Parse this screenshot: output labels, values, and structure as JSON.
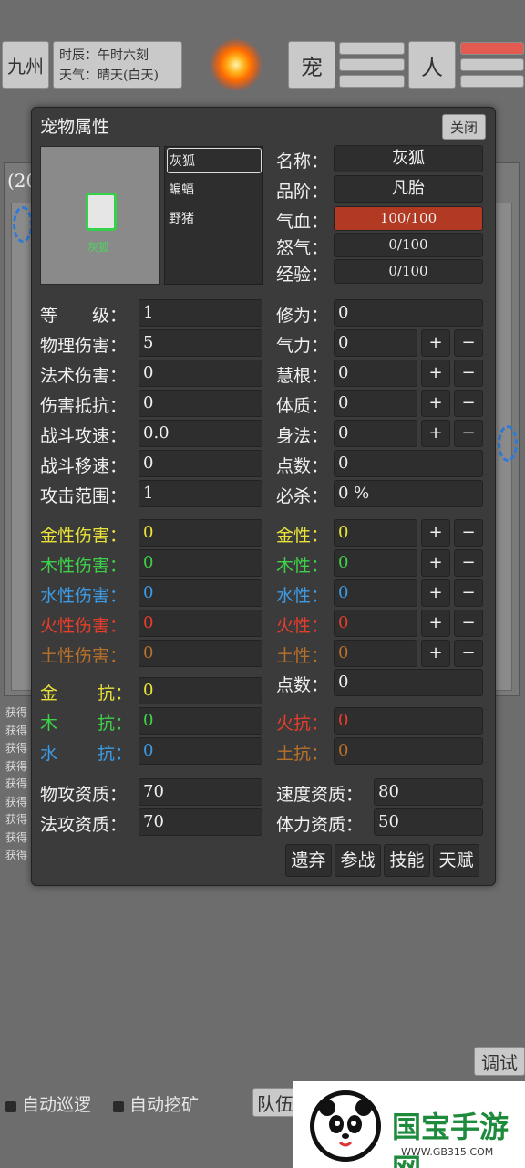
{
  "topbar": {
    "region": "九州",
    "time_line": "时辰：午时六刻",
    "weather_line": "天气：晴天(白天)",
    "pet_tab": "宠",
    "person_tab": "人"
  },
  "background": {
    "partial_label": "(20",
    "log_entry": "获得"
  },
  "modal": {
    "title": "宠物属性",
    "close": "关闭",
    "portrait_name": "灰狐",
    "pets": [
      "灰狐",
      "蝙蝠",
      "野猪"
    ],
    "info": {
      "name_label": "名称：",
      "name": "灰狐",
      "rank_label": "品阶：",
      "rank": "凡胎",
      "hp_label": "气血：",
      "hp": "100/100",
      "rage_label": "怒气：",
      "rage": "0/100",
      "exp_label": "经验：",
      "exp": "0/100"
    },
    "stats_left": [
      {
        "label": "等　　级：",
        "value": "1"
      },
      {
        "label": "物理伤害：",
        "value": "5"
      },
      {
        "label": "法术伤害：",
        "value": "0"
      },
      {
        "label": "伤害抵抗：",
        "value": "0"
      },
      {
        "label": "战斗攻速：",
        "value": "0.0"
      },
      {
        "label": "战斗移速：",
        "value": "0"
      },
      {
        "label": "攻击范围：",
        "value": "1"
      }
    ],
    "stats_right": [
      {
        "label": "修为：",
        "value": "0"
      },
      {
        "label": "气力：",
        "value": "0"
      },
      {
        "label": "慧根：",
        "value": "0"
      },
      {
        "label": "体质：",
        "value": "0"
      },
      {
        "label": "身法：",
        "value": "0"
      },
      {
        "label": "点数：",
        "value": "0"
      },
      {
        "label": "必杀：",
        "value": "0 %"
      }
    ],
    "plus": "+",
    "minus": "−",
    "element_damage": [
      {
        "label": "金性伤害：",
        "value": "0"
      },
      {
        "label": "木性伤害：",
        "value": "0"
      },
      {
        "label": "水性伤害：",
        "value": "0"
      },
      {
        "label": "火性伤害：",
        "value": "0"
      },
      {
        "label": "土性伤害：",
        "value": "0"
      }
    ],
    "element_attr": [
      {
        "label": "金性：",
        "value": "0"
      },
      {
        "label": "木性：",
        "value": "0"
      },
      {
        "label": "水性：",
        "value": "0"
      },
      {
        "label": "火性：",
        "value": "0"
      },
      {
        "label": "土性：",
        "value": "0"
      }
    ],
    "resist_left": [
      {
        "label_a": "金",
        "label_b": "抗：",
        "value": "0"
      },
      {
        "label_a": "木",
        "label_b": "抗：",
        "value": "0"
      },
      {
        "label_a": "水",
        "label_b": "抗：",
        "value": "0"
      }
    ],
    "element_points": {
      "label": "点数：",
      "value": "0"
    },
    "resist_right": [
      {
        "label": "火抗：",
        "value": "0"
      },
      {
        "label": "土抗：",
        "value": "0"
      }
    ],
    "aptitude": {
      "phys_label": "物攻资质：",
      "phys": "70",
      "speed_label": "速度资质：",
      "speed": "80",
      "magic_label": "法攻资质：",
      "magic": "70",
      "stamina_label": "体力资质：",
      "stamina": "50"
    },
    "actions": [
      "遗弃",
      "参战",
      "技能",
      "天赋"
    ]
  },
  "bottom": {
    "debug": "调试",
    "auto_patrol": "自动巡逻",
    "auto_mine": "自动挖矿",
    "team": "队伍"
  },
  "watermark": {
    "text": "国宝手游网",
    "url": "WWW.GB315.COM"
  },
  "colors": {
    "metal": "#e8e23a",
    "wood": "#3fd14a",
    "water": "#3d9be6",
    "fire": "#e83d2a",
    "earth": "#b8702a",
    "hp_bar": "#b33a22"
  }
}
